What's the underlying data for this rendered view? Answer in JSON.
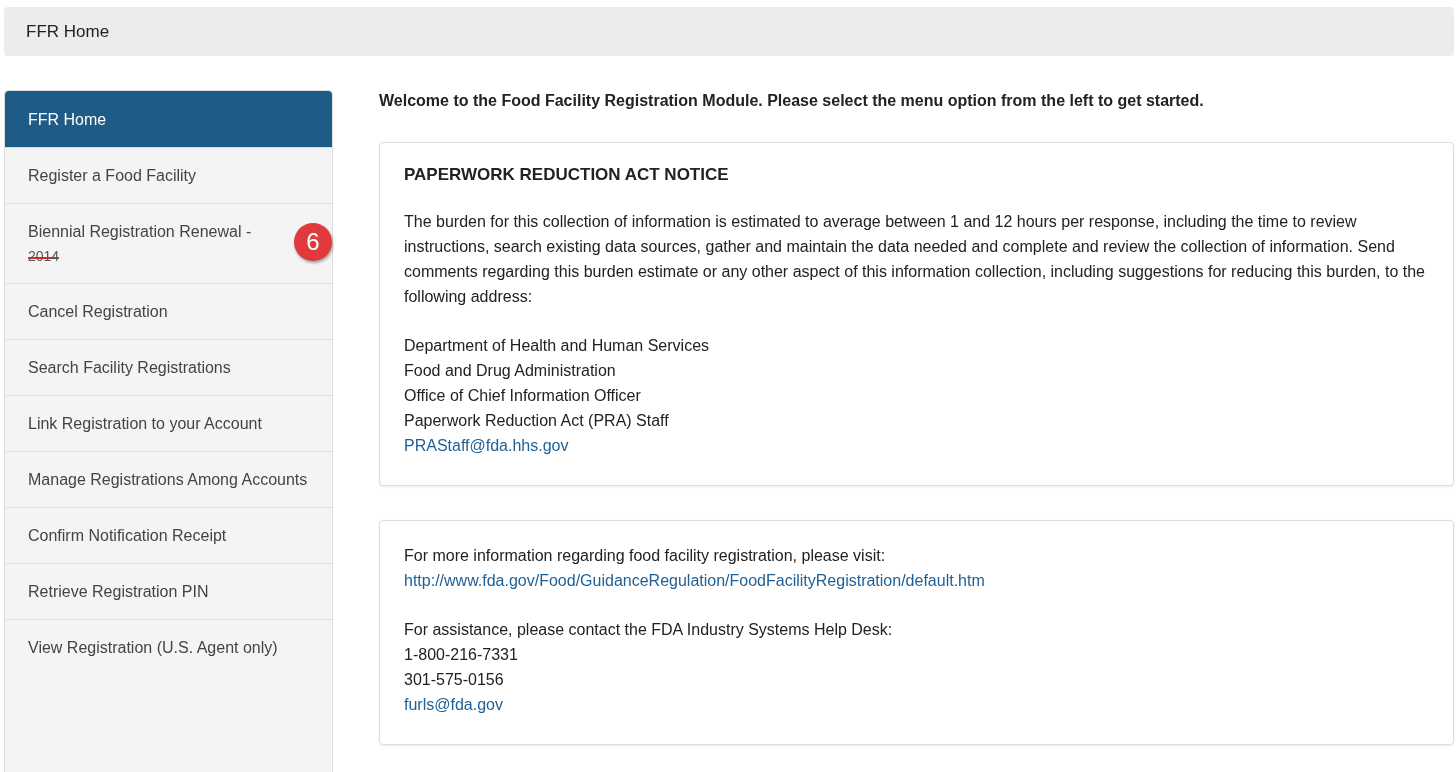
{
  "breadcrumb": {
    "label": "FFR Home"
  },
  "sidebar": {
    "items": [
      {
        "label": "FFR Home",
        "selected": true
      },
      {
        "label": "Register a Food Facility",
        "selected": false
      },
      {
        "label": "Biennial Registration Renewal -",
        "struck_suffix": "2014",
        "selected": false,
        "badge": "6"
      },
      {
        "label": "Cancel Registration",
        "selected": false
      },
      {
        "label": "Search Facility Registrations",
        "selected": false
      },
      {
        "label": "Link Registration to your Account",
        "selected": false
      },
      {
        "label": "Manage Registrations Among Accounts",
        "selected": false
      },
      {
        "label": "Confirm Notification Receipt",
        "selected": false
      },
      {
        "label": "Retrieve Registration PIN",
        "selected": false
      },
      {
        "label": "View Registration (U.S. Agent only)",
        "selected": false
      }
    ]
  },
  "welcome": "Welcome to the Food Facility Registration Module. Please select the menu option from the left to get started.",
  "panels": [
    {
      "title": "PAPERWORK REDUCTION ACT NOTICE",
      "blocks": [
        {
          "kind": "paragraph",
          "text": "The burden for this collection of information is estimated to average between 1 and 12 hours per response, including the time to review instructions, search existing data sources, gather and maintain the data needed and complete and review the collection of information. Send comments regarding this burden estimate or any other aspect of this information collection, including suggestions for reducing this burden, to the following address:"
        },
        {
          "kind": "lines",
          "lines": [
            {
              "kind": "text",
              "text": "Department of Health and Human Services"
            },
            {
              "kind": "text",
              "text": "Food and Drug Administration"
            },
            {
              "kind": "text",
              "text": "Office of Chief Information Officer"
            },
            {
              "kind": "text",
              "text": "Paperwork Reduction Act (PRA) Staff"
            },
            {
              "kind": "link",
              "text": "PRAStaff@fda.hhs.gov"
            }
          ]
        }
      ]
    },
    {
      "blocks": [
        {
          "kind": "lines",
          "lines": [
            {
              "kind": "text",
              "text": "For more information regarding food facility registration, please visit:"
            },
            {
              "kind": "link",
              "text": "http://www.fda.gov/Food/GuidanceRegulation/FoodFacilityRegistration/default.htm"
            }
          ]
        },
        {
          "kind": "lines",
          "lines": [
            {
              "kind": "text",
              "text": "For assistance, please contact the FDA Industry Systems Help Desk:"
            },
            {
              "kind": "text",
              "text": "1-800-216-7331"
            },
            {
              "kind": "text",
              "text": "301-575-0156"
            },
            {
              "kind": "link",
              "text": "furls@fda.gov"
            }
          ]
        }
      ]
    }
  ]
}
